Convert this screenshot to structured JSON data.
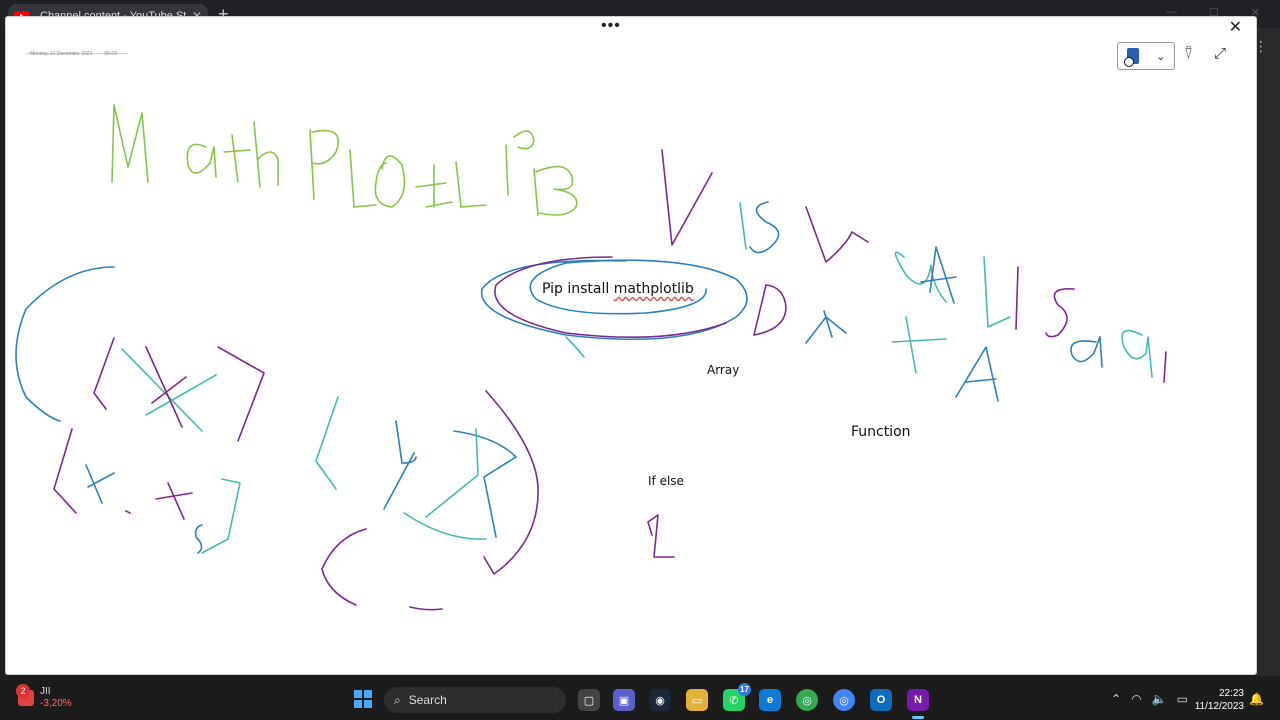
{
  "browser": {
    "tab_title": "Channel content - YouTube Studio",
    "new_tab": "+",
    "tab_close": "✕",
    "menu_dots": "⋮"
  },
  "modal": {
    "drag_handle": "•••",
    "close": "✕",
    "page_date": "Monday, 11 December 2023",
    "page_time": "00:23",
    "tools": {
      "chevron": "⌄",
      "lasso": "⍢",
      "expand": "⤢"
    },
    "typed_text": {
      "pip_prefix": "Pip install ",
      "pip_package": "mathplotlib",
      "array": "Array",
      "function": "Function",
      "if_else": "If else"
    },
    "handwriting": [
      "MathPLotLib",
      "VISuaLIsa",
      "DATA"
    ],
    "ink_colors": [
      "#88c34a",
      "#7b2a8f",
      "#2f7fb8",
      "#48b8b0"
    ]
  },
  "taskbar": {
    "weather_badge": "2",
    "weather_name": "JII",
    "weather_value": "-3,20%",
    "search_label": "Search",
    "whatsapp_badge": "17",
    "clock_time": "22:23",
    "clock_date": "11/12/2023"
  }
}
